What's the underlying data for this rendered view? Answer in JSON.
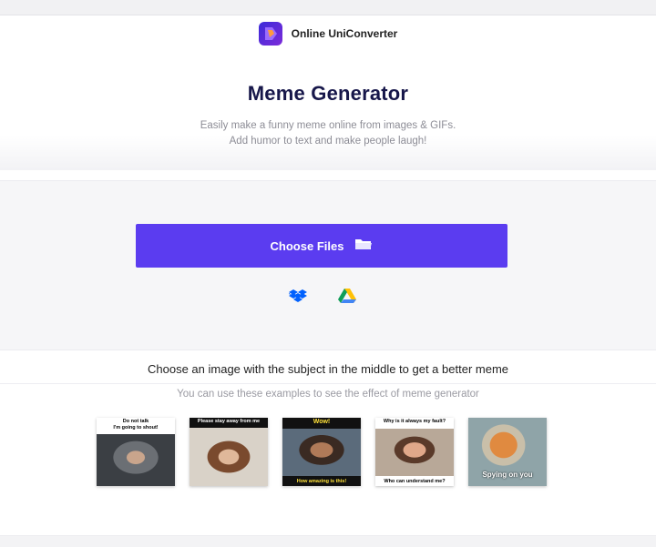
{
  "header": {
    "brand": "Online UniConverter",
    "logo_icon": "uniconverter-logo-icon"
  },
  "hero": {
    "title": "Meme Generator",
    "subtitle_line1": "Easily make a funny meme online from images & GIFs.",
    "subtitle_line2": "Add humor to text and make people laugh!"
  },
  "upload": {
    "button_label": "Choose Files",
    "button_icon": "folder-icon",
    "button_color": "#5b3cf0",
    "sources": [
      "dropbox-icon",
      "google-drive-icon"
    ]
  },
  "tips": {
    "primary": "Choose an image with the subject in the middle to get a better meme",
    "secondary": "You can use these examples to see the effect of meme generator"
  },
  "examples": [
    {
      "top": "Do not talk\nI'm going to shout!",
      "bottom": ""
    },
    {
      "top": "Please stay away from me",
      "bottom": ""
    },
    {
      "top": "Wow!",
      "bottom": "How amazing is this!"
    },
    {
      "top": "Why is it always my fault?",
      "bottom": "Who can understand me?"
    },
    {
      "top": "",
      "bottom": "Spying on you"
    }
  ]
}
